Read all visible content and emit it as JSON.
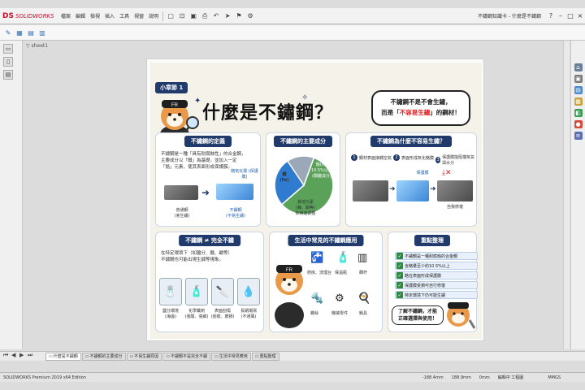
{
  "app": {
    "logo_mark": "DS",
    "logo_text": "SOLIDWORKS",
    "doc_title": "不鏽鋼知識卡 - 什麼是不鏽鋼"
  },
  "menu": [
    "檔案",
    "編輯",
    "檢視",
    "插入",
    "工具",
    "視窗",
    "說明"
  ],
  "tree": {
    "name_label": "sheet1"
  },
  "sheet": {
    "badge": "小章節 1",
    "title": "什麼是不鏽鋼？",
    "bubble": {
      "line1": "不鏽鋼不是不會生鏽，",
      "line2_pre": "而是「",
      "line2_hl": "不容易生鏽",
      "line2_post": "」的鋼材！"
    },
    "card1": {
      "title": "不鏽鋼的定義",
      "text": [
        "不鏽鋼是一種「具有耐腐蝕性」的合金鋼，",
        "主要成分以「鐵」為基礎，並加入一定",
        "「鉻」元素，使其表面形成保護膜。"
      ],
      "callout": "鉻氧化層\n(保護膜)",
      "cap_left": [
        "普通鋼",
        "(會生鏽)"
      ],
      "cap_right": [
        "不鏽鋼",
        "(不易生鏽)"
      ]
    },
    "card2": {
      "title": "不鏽鋼的主要成分",
      "seg_iron": "鐵\n(Fe)",
      "seg_cr": "鉻(Cr)\n10.5%以上\n(關鍵成分)",
      "seg_other": "其他元素\n(鎳、鉬等)\n依用途調整"
    },
    "card3": {
      "title": "不鏽鋼為什麼不容易生鏽？",
      "steps": [
        "鋼材表面接觸空氣",
        "表面形成氧化鉻膜",
        "保護膜能阻擋氧氣與水分"
      ],
      "label_mid": "保護膜",
      "label_end": "自我修復"
    },
    "card4": {
      "title": "不鏽鋼 ≠ 完全不鏽",
      "text": [
        "在特定環境下（如鹽分、酸、鹼等）",
        "不鏽鋼也可能出現生鏽等現象。"
      ],
      "items": [
        {
          "cap": "鹽分環境\n(海邊)"
        },
        {
          "cap": "化學藥劑\n(強酸、強鹼)"
        },
        {
          "cap": "表面刮傷\n(刮痕、磨損)"
        },
        {
          "cap": "長期潮濕\n(不通風)"
        }
      ]
    },
    "card5": {
      "title": "生活中常見的不鏽鋼應用",
      "items": [
        {
          "cap": "廚房、流理台"
        },
        {
          "cap": "保溫瓶"
        },
        {
          "cap": "欄杆"
        },
        {
          "cap": "螺絲"
        },
        {
          "cap": "機械零件"
        },
        {
          "cap": "鍋具"
        }
      ]
    },
    "card6": {
      "title": "重點整理",
      "rows": [
        "不鏽鋼是一種耐腐蝕的合金鋼",
        "含鉻量至少約10.5%以上",
        "鉻在表面形成保護膜",
        "保護膜受損可自行修復",
        "特定環境下仍可能生鏽"
      ],
      "bubble": "了解不鏽鋼，才能\n正確選擇與使用！"
    },
    "mascot_label": "FR"
  },
  "tabs": [
    "什麼是不鏽鋼",
    "不鏽鋼的主要成分",
    "不易生鏽原因",
    "不鏽鋼不是完全不鏽",
    "生活中常見應用",
    "重點整理"
  ],
  "status": {
    "left": "SOLIDWORKS Premium 2019 x64 Edition",
    "mid1": "-188.4mm",
    "mid2": "188.9mm",
    "mid3": "0mm",
    "mid4": "編輯中 工程圖",
    "right": "MMGS"
  },
  "chart_data": {
    "type": "pie",
    "categories": [
      "鐵",
      "鉻",
      "其他元素"
    ],
    "values": [
      58,
      27,
      15
    ],
    "title": "",
    "colors": [
      "#5aa15a",
      "#2e7bd0",
      "#9aa8b8"
    ]
  }
}
